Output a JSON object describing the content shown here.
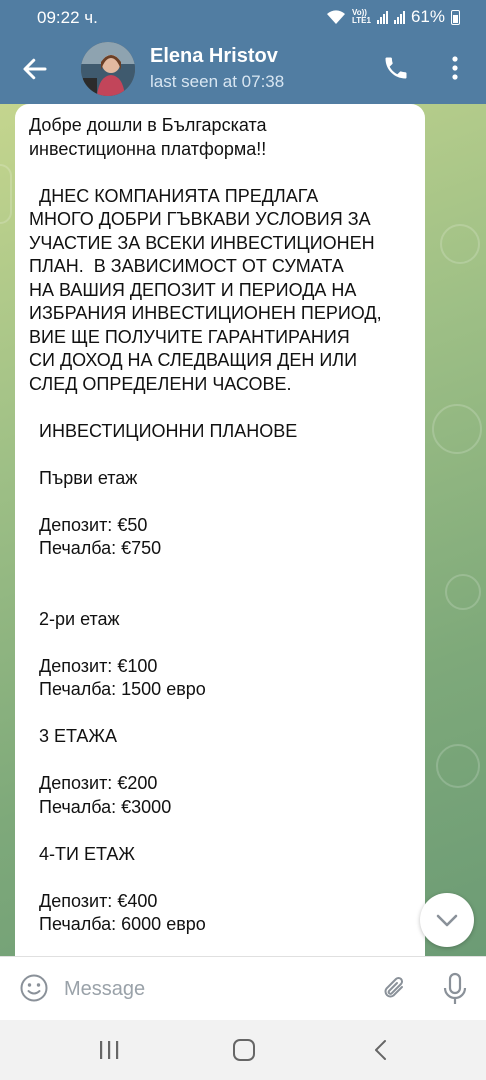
{
  "status_bar": {
    "time": "09:22 ч.",
    "network_label": "Vo))\nLTE1",
    "battery": "61%"
  },
  "header": {
    "contact_name": "Elena Hristov",
    "last_seen": "last seen at 07:38"
  },
  "message": {
    "lines": [
      "Добре дошли в Българската",
      "инвестиционна платформа!!",
      "",
      "  ДНЕС КОМПАНИЯТА ПРЕДЛАГА",
      "МНОГО ДОБРИ ГЪВКАВИ УСЛОВИЯ ЗА",
      "УЧАСТИЕ ЗА ВСЕКИ ИНВЕСТИЦИОНЕН",
      "ПЛАН.  В ЗАВИСИМОСТ ОТ СУМАТА",
      "НА ВАШИЯ ДЕПОЗИТ И ПЕРИОДА НА",
      "ИЗБРАНИЯ ИНВЕСТИЦИОНЕН ПЕРИОД,",
      "ВИЕ ЩЕ ПОЛУЧИТЕ ГАРАНТИРАНИЯ",
      "СИ ДОХОД НА СЛЕДВАЩИЯ ДЕН ИЛИ",
      "СЛЕД ОПРЕДЕЛЕНИ ЧАСОВЕ.",
      "",
      "  ИНВЕСТИЦИОННИ ПЛАНОВЕ",
      "",
      "  Първи етаж",
      "",
      "  Депозит: €50",
      "  Печалба: €750",
      "",
      "",
      "  2-ри етаж",
      "",
      "  Депозит: €100",
      "  Печалба: 1500 евро",
      "",
      "  3 ЕТАЖА",
      "",
      "  Депозит: €200",
      "  Печалба: €3000",
      "",
      "  4-ТИ ЕТАЖ",
      "",
      "  Депозит: €400",
      "  Печалба: 6000 евро"
    ]
  },
  "composer": {
    "placeholder": "Message"
  },
  "icons": {
    "back": "arrow-left-icon",
    "call": "phone-icon",
    "more": "more-vertical-icon",
    "emoji": "emoji-icon",
    "attach": "paperclip-icon",
    "mic": "microphone-icon",
    "scroll_down": "chevron-down-icon"
  },
  "colors": {
    "header": "#517da2",
    "bubble": "#ffffff",
    "wallpaper": "#9fc086"
  }
}
